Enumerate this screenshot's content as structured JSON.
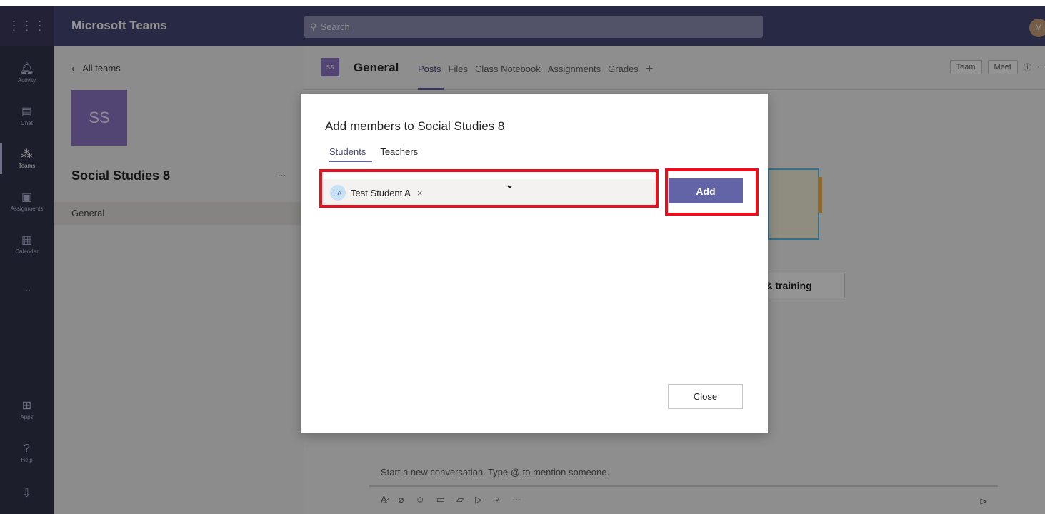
{
  "topbar": {
    "app_title": "Microsoft Teams",
    "search_placeholder": "Search",
    "avatar_initials": "M"
  },
  "rail": {
    "items": [
      {
        "label": "Activity",
        "icon": "bell-icon"
      },
      {
        "label": "Chat",
        "icon": "chat-icon"
      },
      {
        "label": "Teams",
        "icon": "teams-icon"
      },
      {
        "label": "Assignments",
        "icon": "assignments-icon"
      },
      {
        "label": "Calendar",
        "icon": "calendar-icon"
      },
      {
        "label": "...",
        "icon": "more-icon"
      },
      {
        "label": "Apps",
        "icon": "apps-icon"
      },
      {
        "label": "Help",
        "icon": "help-icon"
      }
    ]
  },
  "team_panel": {
    "back_label": "All teams",
    "team_initials": "SS",
    "team_name": "Social Studies 8",
    "more_label": "...",
    "channel": "General"
  },
  "channel_header": {
    "badge": "SS",
    "name": "General",
    "tabs": [
      "Posts",
      "Files",
      "Class Notebook",
      "Assignments",
      "Grades"
    ],
    "plus": "+",
    "right": {
      "team": "Team",
      "meet": "Meet",
      "info": "ⓘ",
      "more": "···"
    }
  },
  "main": {
    "help_button": "lp & training",
    "compose_placeholder": "Start a new conversation. Type @ to mention someone."
  },
  "dialog": {
    "title": "Add members to Social Studies 8",
    "tabs": {
      "students": "Students",
      "teachers": "Teachers"
    },
    "chip": {
      "initials": "TA",
      "name": "Test Student A",
      "remove": "×"
    },
    "add_label": "Add",
    "close_label": "Close"
  },
  "colors": {
    "brand": "#464775",
    "accent": "#6264a7",
    "highlight": "#e8101a"
  }
}
